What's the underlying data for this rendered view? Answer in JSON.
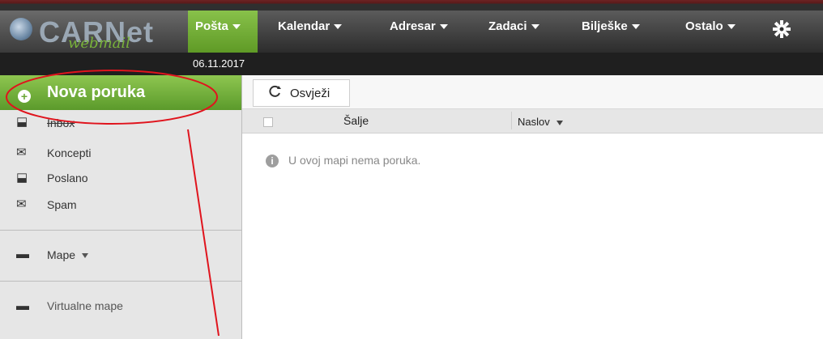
{
  "app": {
    "logo_text": "CARNet",
    "logo_subtext": "webmail"
  },
  "menu": {
    "items": [
      {
        "label": "Pošta"
      },
      {
        "label": "Kalendar"
      },
      {
        "label": "Adresar"
      },
      {
        "label": "Zadaci"
      },
      {
        "label": "Bilješke"
      },
      {
        "label": "Ostalo"
      }
    ],
    "settings_icon": "gear-icon"
  },
  "date": "06.11.2017",
  "sidebar": {
    "new_message": "Nova poruka",
    "folders": [
      {
        "label": "Inbox",
        "icon": "inbox-icon"
      },
      {
        "label": "Koncepti",
        "icon": "drafts-icon"
      },
      {
        "label": "Poslano",
        "icon": "sent-icon"
      },
      {
        "label": "Spam",
        "icon": "spam-icon"
      }
    ],
    "mape": "Mape",
    "virtual": "Virtualne mape"
  },
  "toolbar": {
    "refresh": "Osvježi"
  },
  "list": {
    "col_from": "Šalje",
    "col_subject": "Naslov",
    "empty": "U ovoj mapi nema poruka."
  },
  "colors": {
    "accent_green": "#7ab73f",
    "annotation_red": "#e0141d"
  }
}
